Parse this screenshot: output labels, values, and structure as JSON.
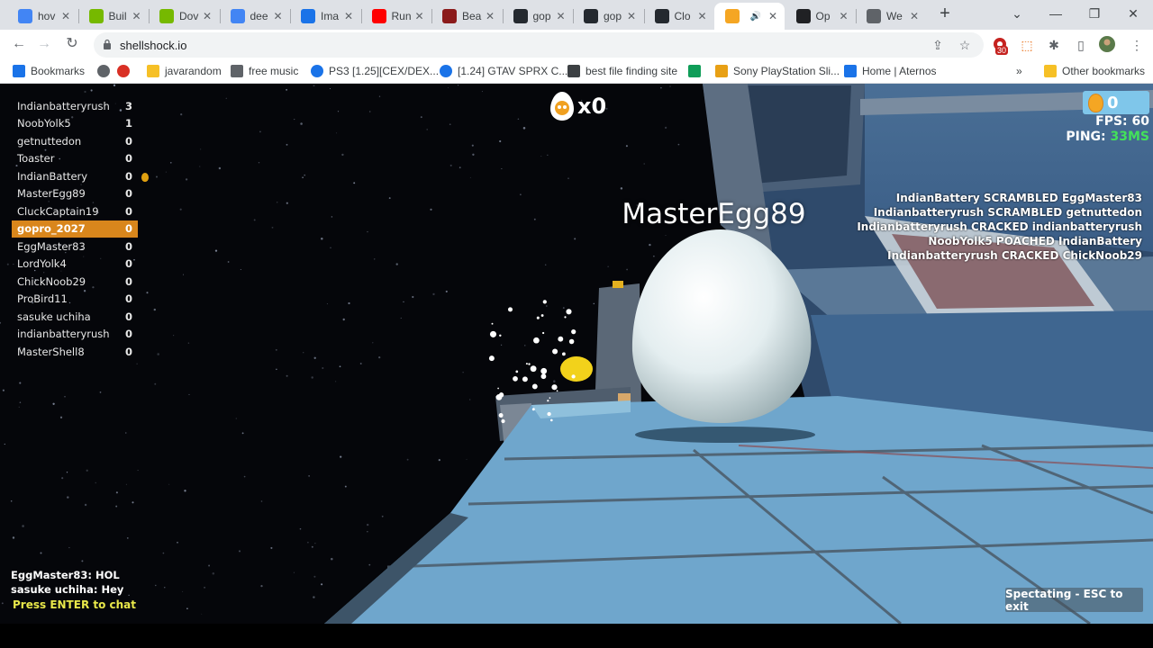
{
  "browser": {
    "tabs": [
      {
        "title": "hov",
        "icon": "google-g-icon",
        "color": "#4285f4"
      },
      {
        "title": "Buil",
        "icon": "nvidia-icon",
        "color": "#76b900"
      },
      {
        "title": "Dov",
        "icon": "nvidia-icon",
        "color": "#76b900"
      },
      {
        "title": "dee",
        "icon": "google-g-icon",
        "color": "#4285f4"
      },
      {
        "title": "Ima",
        "icon": "chart-icon",
        "color": "#1a73e8"
      },
      {
        "title": "Run",
        "icon": "youtube-icon",
        "color": "#ff0000"
      },
      {
        "title": "Bea",
        "icon": "m-icon",
        "color": "#8b1b1b"
      },
      {
        "title": "gop",
        "icon": "github-icon",
        "color": "#24292f"
      },
      {
        "title": "gop",
        "icon": "github-icon",
        "color": "#24292f"
      },
      {
        "title": "Clo",
        "icon": "github-icon",
        "color": "#24292f"
      },
      {
        "title": "",
        "icon": "shellshock-icon",
        "color": "#f5a623",
        "active": true
      },
      {
        "title": "Op",
        "icon": "openai-icon",
        "color": "#202124"
      },
      {
        "title": "We",
        "icon": "globe-icon",
        "color": "#5f6368"
      }
    ],
    "url": "shellshock.io",
    "extension_badge": "30",
    "bookmarks": [
      {
        "label": "Bookmarks",
        "icon": "star-icon"
      },
      {
        "label": "",
        "icon": "chrome-icon"
      },
      {
        "label": "",
        "icon": "heart-icon"
      },
      {
        "label": "javarandom",
        "icon": "folder-icon"
      },
      {
        "label": "free music",
        "icon": "music-icon"
      },
      {
        "label": "PS3 [1.25][CEX/DEX...",
        "icon": "e-icon"
      },
      {
        "label": "[1.24] GTAV SPRX C...",
        "icon": "e-icon"
      },
      {
        "label": "best file finding site",
        "icon": "printer-icon"
      },
      {
        "label": "",
        "icon": "green-app-icon"
      },
      {
        "label": "Sony PlayStation Sli...",
        "icon": "shop-icon"
      },
      {
        "label": "Home | Aternos",
        "icon": "aternos-icon"
      },
      {
        "label": "Other bookmarks",
        "icon": "folder-icon"
      }
    ]
  },
  "game": {
    "scoreboard": [
      {
        "name": "Indianbatteryrush",
        "score": "3"
      },
      {
        "name": "NoobYolk5",
        "score": "1"
      },
      {
        "name": "getnuttedon",
        "score": "0"
      },
      {
        "name": "Toaster",
        "score": "0"
      },
      {
        "name": "IndianBattery",
        "score": "0",
        "egg": true
      },
      {
        "name": "MasterEgg89",
        "score": "0"
      },
      {
        "name": "CluckCaptain19",
        "score": "0"
      },
      {
        "name": "gopro_2027",
        "score": "0",
        "me": true
      },
      {
        "name": "EggMaster83",
        "score": "0"
      },
      {
        "name": "LordYolk4",
        "score": "0"
      },
      {
        "name": "ChickNoob29",
        "score": "0"
      },
      {
        "name": "ProBird11",
        "score": "0"
      },
      {
        "name": "sasuke uchiha",
        "score": "0"
      },
      {
        "name": "indianbatteryrush",
        "score": "0"
      },
      {
        "name": "MasterShell8",
        "score": "0"
      }
    ],
    "kill_streak": "x0",
    "coins": "0",
    "fps_label": "FPS: 60",
    "ping_label": "PING:",
    "ping_value": "33MS",
    "spectating_player": "MasterEgg89",
    "killfeed": [
      "IndianBattery SCRAMBLED EggMaster83",
      "Indianbatteryrush SCRAMBLED getnuttedon",
      "Indianbatteryrush CRACKED indianbatteryrush",
      "NoobYolk5 POACHED IndianBattery",
      "Indianbatteryrush CRACKED ChickNoob29"
    ],
    "chat": [
      "EggMaster83: HOL",
      "sasuke uchiha: Hey"
    ],
    "chat_hint": "Press ENTER to chat",
    "spectate_label": "Spectating - ESC to exit"
  },
  "colors": {
    "highlight_row": "#d9861c",
    "ping_good": "#43e15a",
    "chat_hint": "#e9e84a",
    "floor": "#6fa6cc"
  }
}
